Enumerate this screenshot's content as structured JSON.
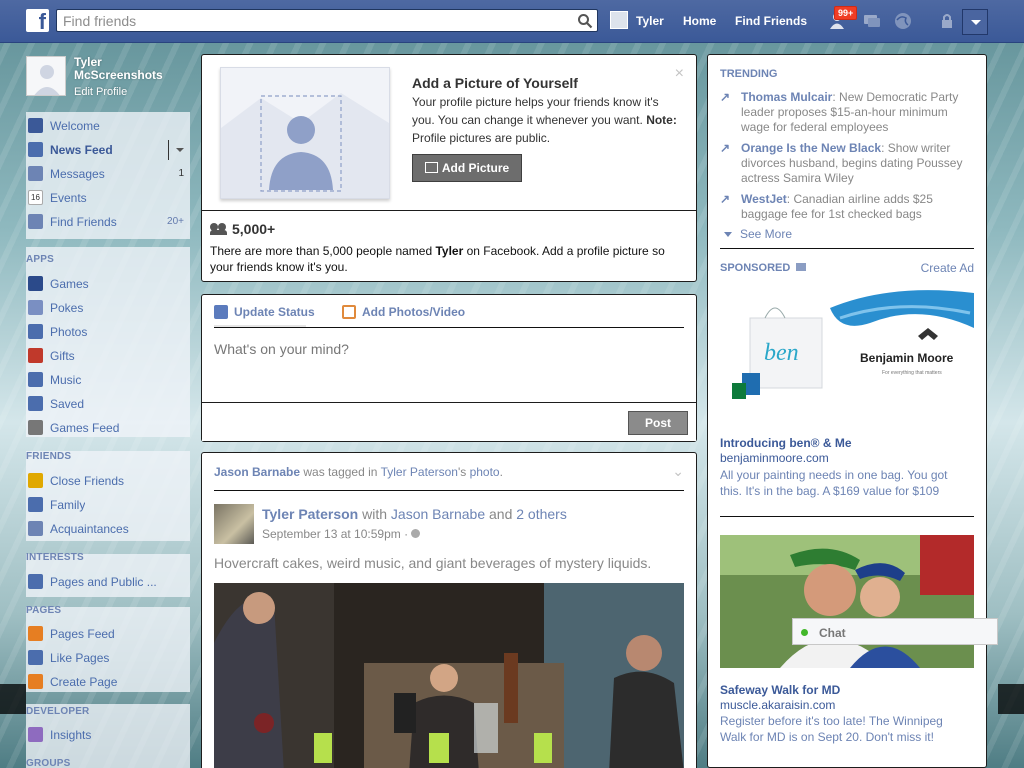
{
  "topbar": {
    "logo": "f",
    "search_placeholder": "Find friends",
    "user": "Tyler",
    "home": "Home",
    "find_friends": "Find Friends",
    "notif_count": "99+",
    "icons": [
      "friend-requests-icon",
      "messages-icon",
      "notifications-icon",
      "privacy-icon",
      "settings-icon"
    ]
  },
  "sidebar": {
    "profile_name": "Tyler McScreenshots",
    "edit_profile": "Edit Profile",
    "favorites": [
      {
        "label": "Welcome",
        "count": "",
        "icon": "welcome-icon",
        "color": "#3b5998"
      },
      {
        "label": "News Feed",
        "count": "",
        "icon": "news-feed-icon",
        "color": "#4b6dad"
      },
      {
        "label": "Messages",
        "count": "1",
        "icon": "messages-icon",
        "color": "#6d84b4"
      },
      {
        "label": "Events",
        "count": "",
        "icon": "calendar-icon",
        "color": "#c0392b"
      },
      {
        "label": "Find Friends",
        "count": "20+",
        "icon": "find-friends-icon",
        "color": "#6d84b4"
      }
    ],
    "apps_head": "APPS",
    "apps": [
      {
        "label": "Games",
        "icon": "games-icon",
        "color": "#2b4a8a"
      },
      {
        "label": "Pokes",
        "icon": "pokes-icon",
        "color": "#7a8fc2"
      },
      {
        "label": "Photos",
        "icon": "photos-icon",
        "color": "#4b6dad"
      },
      {
        "label": "Gifts",
        "icon": "gift-icon",
        "color": "#c0392b"
      },
      {
        "label": "Music",
        "icon": "music-icon",
        "color": "#4b6dad"
      },
      {
        "label": "Saved",
        "icon": "saved-icon",
        "color": "#4b6dad"
      },
      {
        "label": "Games Feed",
        "icon": "gamepad-icon",
        "color": "#555555"
      }
    ],
    "friends_head": "FRIENDS",
    "friends": [
      {
        "label": "Close Friends",
        "icon": "star-icon",
        "color": "#e0a800"
      },
      {
        "label": "Family",
        "icon": "family-icon",
        "color": "#4b6dad"
      },
      {
        "label": "Acquaintances",
        "icon": "acquaintances-icon",
        "color": "#6d84b4"
      }
    ],
    "interests_head": "INTERESTS",
    "interests": [
      {
        "label": "Pages and Public ...",
        "icon": "rss-icon",
        "color": "#4b6dad"
      }
    ],
    "pages_head": "PAGES",
    "pages": [
      {
        "label": "Pages Feed",
        "icon": "pages-feed-icon",
        "color": "#e67e22"
      },
      {
        "label": "Like Pages",
        "icon": "like-icon",
        "color": "#4b6dad"
      },
      {
        "label": "Create Page",
        "icon": "create-page-icon",
        "color": "#e67e22"
      }
    ],
    "developer_head": "DEVELOPER",
    "developer": [
      {
        "label": "Insights",
        "icon": "insights-icon",
        "color": "#8e6bbf"
      }
    ],
    "groups_head": "GROUPS"
  },
  "profile_prompt": {
    "title": "Add a Picture of Yourself",
    "text": "Your profile picture helps your friends know it's you. You can change it whenever you want.",
    "note_label": "Note:",
    "note_text": " Profile pictures are public.",
    "button": "Add Picture",
    "count": "5,000+",
    "desc_pre": "There are more than 5,000 people named ",
    "desc_name": "Tyler",
    "desc_post": " on Facebook. Add a profile picture so your friends know it's you."
  },
  "composer": {
    "tab_status": "Update Status",
    "tab_photos": "Add Photos/Video",
    "placeholder": "What's on your mind?",
    "post": "Post"
  },
  "story": {
    "head_actor": "Jason Barnabe",
    "head_mid": " was tagged in ",
    "head_owner": "Tyler Paterson",
    "head_poss": "'s ",
    "head_obj": "photo",
    "head_end": ".",
    "actor": "Tyler Paterson",
    "with": " with ",
    "tagged": "Jason Barnabe",
    "and": " and ",
    "others": "2 others",
    "time": "September 13 at 10:59pm · ",
    "text": "Hovercraft cakes, weird music, and giant beverages of mystery liquids."
  },
  "trending": {
    "head": "TRENDING",
    "items": [
      {
        "topic": "Thomas Mulcair",
        "desc": ": New Democratic Party leader proposes $15-an-hour minimum wage for federal employees"
      },
      {
        "topic": "Orange Is the New Black",
        "desc": ": Show writer divorces husband, begins dating Poussey actress Samira Wiley"
      },
      {
        "topic": "WestJet",
        "desc": ": Canadian airline adds $25 baggage fee for 1st checked bags"
      }
    ],
    "see_more": "See More"
  },
  "sponsored": {
    "head": "SPONSORED",
    "create_ad": "Create Ad",
    "ads": [
      {
        "image_brand": "Benjamin Moore",
        "image_tagline": "For everything that matters",
        "image_bag": "ben",
        "title": "Introducing ben® & Me",
        "domain": "benjaminmoore.com",
        "text": "All your painting needs in one bag. You got this. It's in the bag. A $169 value for $109"
      },
      {
        "title": "Safeway Walk for MD",
        "domain": "muscle.akaraisin.com",
        "text": "Register before it's too late! The Winnipeg Walk for MD is on Sept 20. Don't miss it!"
      }
    ]
  },
  "chat": {
    "label": "Chat"
  }
}
